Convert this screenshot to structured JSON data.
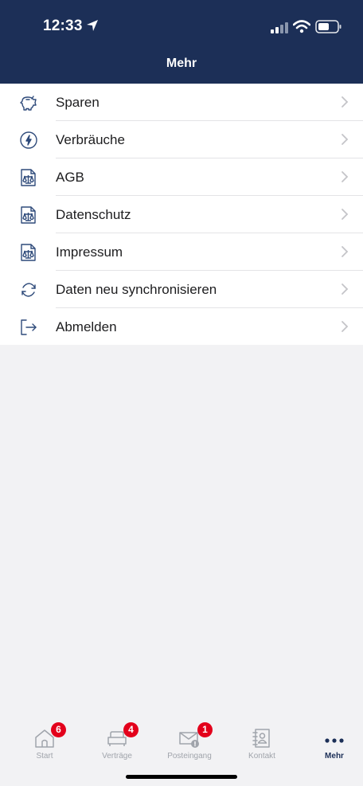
{
  "status_bar": {
    "time": "12:33"
  },
  "header": {
    "title": "Mehr"
  },
  "menu": {
    "items": [
      {
        "label": "Sparen",
        "icon": "piggy-bank-icon"
      },
      {
        "label": "Verbräuche",
        "icon": "energy-gauge-icon"
      },
      {
        "label": "AGB",
        "icon": "legal-document-icon"
      },
      {
        "label": "Datenschutz",
        "icon": "legal-document-icon"
      },
      {
        "label": "Impressum",
        "icon": "legal-document-icon"
      },
      {
        "label": "Daten neu synchronisieren",
        "icon": "sync-icon"
      },
      {
        "label": "Abmelden",
        "icon": "logout-icon"
      }
    ]
  },
  "tabbar": {
    "tabs": [
      {
        "label": "Start",
        "badge": "6",
        "icon": "home-icon"
      },
      {
        "label": "Verträge",
        "badge": "4",
        "icon": "sofa-icon"
      },
      {
        "label": "Posteingang",
        "badge": "1",
        "icon": "mail-icon"
      },
      {
        "label": "Kontakt",
        "badge": "",
        "icon": "contact-book-icon"
      },
      {
        "label": "Mehr",
        "badge": "",
        "icon": "more-dots-icon",
        "active": true
      }
    ]
  },
  "colors": {
    "header_bg": "#1c2f57",
    "badge": "#e3001b",
    "icon_blue": "#2e4a7a",
    "inactive": "#a0a4ab"
  }
}
